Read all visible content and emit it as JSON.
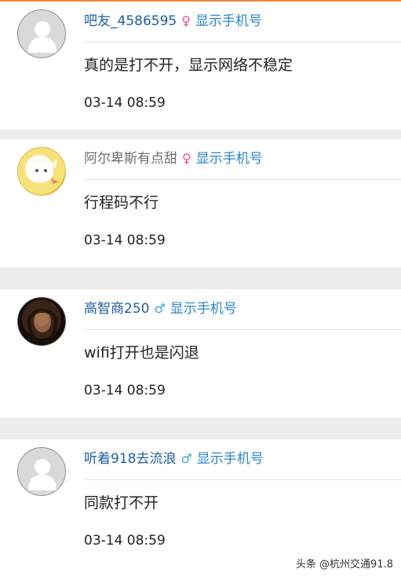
{
  "comments": [
    {
      "username": "吧友_4586595",
      "gender": "♀",
      "phone_link": "显示手机号",
      "text": "真的是打不开，显示网络不稳定",
      "time": "03-14 08:59"
    },
    {
      "username": "阿尔卑斯有点甜",
      "gender": "♀",
      "phone_link": "显示手机号",
      "text": "行程码不行",
      "time": "03-14 08:59"
    },
    {
      "username": "高智商250",
      "gender": "♂",
      "phone_link": "显示手机号",
      "text": "wifi打开也是闪退",
      "time": "03-14 08:59"
    },
    {
      "username": "听着918去流浪",
      "gender": "♂",
      "phone_link": "显示手机号",
      "text": "同款打不开",
      "time": "03-14 08:59"
    }
  ],
  "watermark": "头条 @杭州交通91.8",
  "colors": {
    "top_accent": "#e8893a",
    "username": "#1f5f9f",
    "phone_link": "#2a84c9",
    "female": "#ec4f9a",
    "male": "#3ba3e6"
  }
}
